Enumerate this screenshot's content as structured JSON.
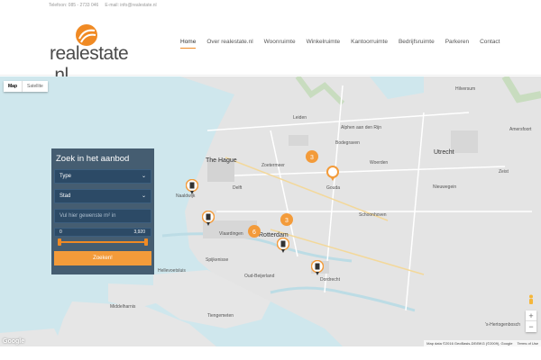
{
  "topbar": {
    "phone": "Telefoon: 085 - 2733 046",
    "email": "E-mail: info@realestate.nl"
  },
  "brand": {
    "name": "realestate",
    "dot": " .",
    "tld": "nl",
    "color": "#f08a24"
  },
  "nav": {
    "items": [
      "Home",
      "Over realestate.nl",
      "Woonruimte",
      "Winkelruimte",
      "Kantoorruimte",
      "Bedrijfsruimte",
      "Parkeren",
      "Contact"
    ],
    "active": "Home"
  },
  "map": {
    "type_buttons": [
      "Map",
      "Satellite"
    ],
    "selected_type": "Map",
    "cities": [
      {
        "name": "The Hague",
        "big": true
      },
      {
        "name": "Zoetermeer",
        "big": false
      },
      {
        "name": "Leiden",
        "big": false
      },
      {
        "name": "Utrecht",
        "big": true
      },
      {
        "name": "Gouda",
        "big": false
      },
      {
        "name": "Delft",
        "big": false
      },
      {
        "name": "Rotterdam",
        "big": true
      },
      {
        "name": "Dordrecht",
        "big": false
      },
      {
        "name": "Naaldwijk",
        "big": false
      },
      {
        "name": "Vlaardingen",
        "big": false
      },
      {
        "name": "Spijkenisse",
        "big": false
      },
      {
        "name": "Nieuwegein",
        "big": false
      },
      {
        "name": "Amersfoort",
        "big": false
      },
      {
        "name": "Hilversum",
        "big": false
      },
      {
        "name": "Schoonhoven",
        "big": false
      },
      {
        "name": "Middelharnis",
        "big": false
      },
      {
        "name": "'s-Hertogenbosch",
        "big": false
      },
      {
        "name": "Zeist",
        "big": false
      },
      {
        "name": "Woerden",
        "big": false
      },
      {
        "name": "Alphen aan den Rijn",
        "big": false
      },
      {
        "name": "Bodegraven",
        "big": false
      },
      {
        "name": "Hellevoetsluis",
        "big": false
      },
      {
        "name": "Tiengemeten",
        "big": false
      },
      {
        "name": "Oud-Beijerland",
        "big": false
      }
    ],
    "cluster_labels": [
      "3",
      "6",
      "3"
    ],
    "attribution": [
      "Map data ©2016 GeoBasis-DE/BKG (©2009), Google",
      "Terms of Use"
    ],
    "google_logo": "Google"
  },
  "search": {
    "title": "Zoek in het aanbod",
    "type_label": "Type",
    "city_label": "Stad",
    "area_placeholder": "Vul hier gewenste m² in",
    "range_min": "0",
    "range_max": "3,920",
    "submit_label": "Zoeken!"
  },
  "colors": {
    "accent": "#f08a24",
    "panel": "#2d445a",
    "water": "#cfe7ed",
    "land": "#e4e4e4"
  }
}
